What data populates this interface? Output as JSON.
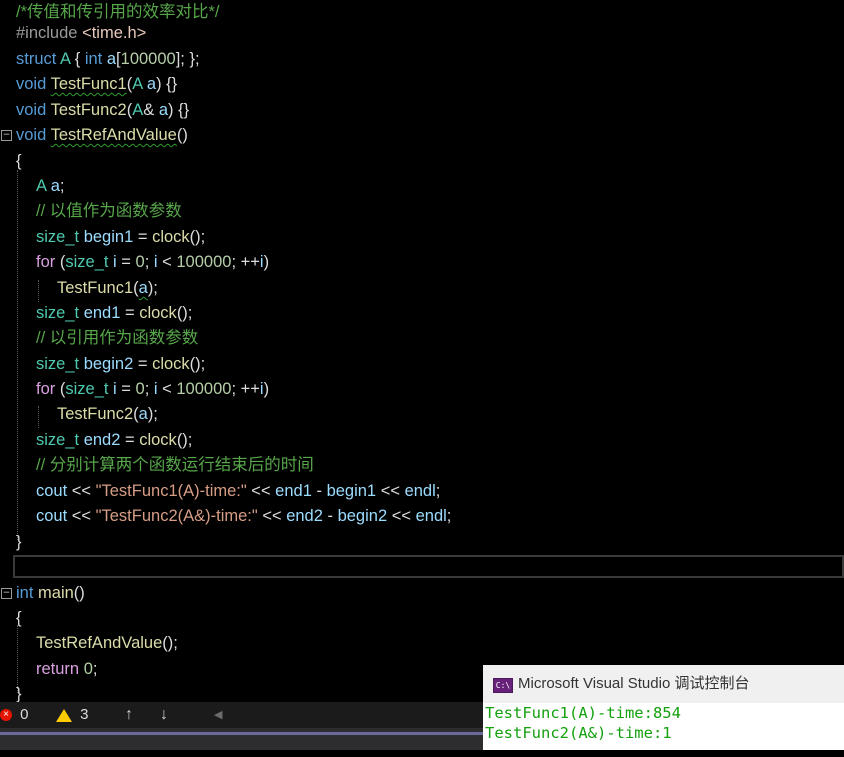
{
  "editor": {
    "lines": {
      "l1": "/*传值和传引用的效率对比*/",
      "l2_pp": "#include ",
      "l2_inc": "<time.h>",
      "l3_kw": "struct",
      "l3_ty": "A",
      "l3_a": " { ",
      "l3_int": "int",
      "l3_b": " ",
      "l3_var": "a",
      "l3_c": "[",
      "l3_num": "100000",
      "l3_d": "]; };",
      "l4_kw": "void",
      "l4_fn": "TestFunc1",
      "l4_a": "(",
      "l4_ty": "A",
      "l4_var": " a",
      "l4_b": ") {}",
      "l5_kw": "void",
      "l5_fn": "TestFunc2",
      "l5_a": "(",
      "l5_ty": "A",
      "l5_amp": "& ",
      "l5_var": "a",
      "l5_b": ") {}",
      "l6_kw": "void",
      "l6_fn": "TestRefAndValue",
      "l6_a": "()",
      "l7": "{",
      "l8_ty": "A",
      "l8_var": " a",
      "l8_a": ";",
      "l9": "// 以值作为函数参数",
      "l10_ty": "size_t",
      "l10_var": " begin1",
      "l10_a": " = ",
      "l10_fn": "clock",
      "l10_b": "();",
      "l11_kw": "for",
      "l11_a": " (",
      "l11_ty": "size_t",
      "l11_var": " i",
      "l11_b": " = ",
      "l11_n0": "0",
      "l11_c": "; ",
      "l11_var2": "i",
      "l11_d": " < ",
      "l11_n1": "100000",
      "l11_e": "; ++",
      "l11_var3": "i",
      "l11_f": ")",
      "l12_fn": "TestFunc1",
      "l12_a": "(",
      "l12_var": "a",
      "l12_b": ");",
      "l13_ty": "size_t",
      "l13_var": " end1",
      "l13_a": " = ",
      "l13_fn": "clock",
      "l13_b": "();",
      "l14": "// 以引用作为函数参数",
      "l15_ty": "size_t",
      "l15_var": " begin2",
      "l15_a": " = ",
      "l15_fn": "clock",
      "l15_b": "();",
      "l16_kw": "for",
      "l16_a": " (",
      "l16_ty": "size_t",
      "l16_var": " i",
      "l16_b": " = ",
      "l16_n0": "0",
      "l16_c": "; ",
      "l16_var2": "i",
      "l16_d": " < ",
      "l16_n1": "100000",
      "l16_e": "; ++",
      "l16_var3": "i",
      "l16_f": ")",
      "l17_fn": "TestFunc2",
      "l17_a": "(",
      "l17_var": "a",
      "l17_b": ");",
      "l18_ty": "size_t",
      "l18_var": " end2",
      "l18_a": " = ",
      "l18_fn": "clock",
      "l18_b": "();",
      "l19": "// 分别计算两个函数运行结束后的时间",
      "l20_var": "cout",
      "l20_a": " << ",
      "l20_str": "\"TestFunc1(A)-time:\"",
      "l20_b": " << ",
      "l20_var2": "end1",
      "l20_c": " - ",
      "l20_var3": "begin1",
      "l20_d": " << ",
      "l20_var4": "endl",
      "l20_e": ";",
      "l21_var": "cout",
      "l21_a": " << ",
      "l21_str": "\"TestFunc2(A&)-time:\"",
      "l21_b": " << ",
      "l21_var2": "end2",
      "l21_c": " - ",
      "l21_var3": "begin2",
      "l21_d": " << ",
      "l21_var4": "endl",
      "l21_e": ";",
      "l22": "}",
      "l24_kw": "int",
      "l24_fn": " main",
      "l24_a": "()",
      "l25": "{",
      "l26_fn": "TestRefAndValue",
      "l26_a": "();",
      "l27_kw": "return",
      "l27_a": " ",
      "l27_num": "0",
      "l27_b": ";",
      "l28": "}"
    },
    "fold_minus": "−"
  },
  "status_bar": {
    "errors": "0",
    "warnings": "3",
    "up_arrow": "↑",
    "down_arrow": "↓",
    "left_arrow": "◀",
    "error_glyph": "×"
  },
  "console": {
    "title": "Microsoft Visual Studio 调试控制台",
    "icon_text": "C:\\",
    "output": [
      "TestFunc1(A)-time:854",
      "TestFunc2(A&)-time:1"
    ]
  },
  "colors": {
    "background": "#000000",
    "keyword": "#569cd6",
    "type": "#4ec9b0",
    "function": "#dcdcaa",
    "variable": "#9cdcfe",
    "comment": "#57a64a",
    "string": "#d69d85",
    "console_text": "#13a10e"
  }
}
